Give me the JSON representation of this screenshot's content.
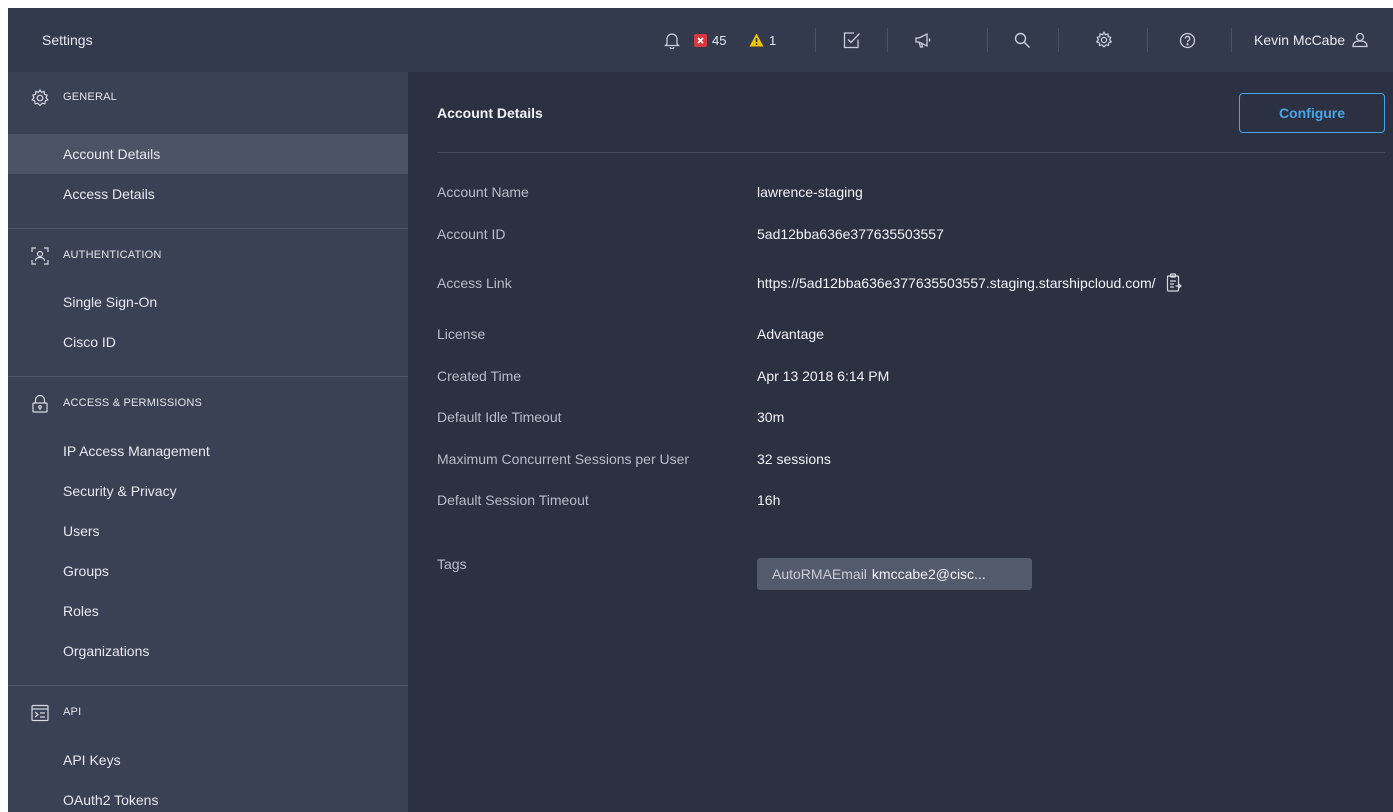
{
  "app": {
    "title": "Settings"
  },
  "topbar": {
    "errors_count": "45",
    "warnings_count": "1",
    "user_name": "Kevin McCabe",
    "icons": [
      "bell-icon",
      "error-icon",
      "warning-icon",
      "checklist-icon",
      "megaphone-icon",
      "search-icon",
      "gear-icon",
      "help-icon",
      "user-icon"
    ],
    "colors": {
      "error": "#d9363e",
      "warning": "#f2c500"
    }
  },
  "sidebar": {
    "sections": [
      {
        "title": "GENERAL",
        "icon": "gear-icon",
        "items": [
          "Account Details",
          "Access Details"
        ]
      },
      {
        "title": "AUTHENTICATION",
        "icon": "user-scan-icon",
        "items": [
          "Single Sign-On",
          "Cisco ID"
        ]
      },
      {
        "title": "ACCESS & PERMISSIONS",
        "icon": "lock-icon",
        "items": [
          "IP Access Management",
          "Security & Privacy",
          "Users",
          "Groups",
          "Roles",
          "Organizations"
        ]
      },
      {
        "title": "API",
        "icon": "terminal-icon",
        "items": [
          "API Keys",
          "OAuth2 Tokens"
        ]
      }
    ],
    "active_item": "Account Details"
  },
  "main": {
    "title": "Account Details",
    "configure_label": "Configure",
    "accent": "#49a6e6",
    "details": [
      {
        "label": "Account Name",
        "value": "lawrence-staging"
      },
      {
        "label": "Account ID",
        "value": "5ad12bba636e377635503557"
      },
      {
        "label": "Access Link",
        "value": "https://5ad12bba636e377635503557.staging.starshipcloud.com/"
      },
      {
        "label": "License",
        "value": "Advantage"
      },
      {
        "label": "Created Time",
        "value": "Apr 13 2018 6:14 PM"
      },
      {
        "label": "Default Idle Timeout",
        "value": "30m"
      },
      {
        "label": "Maximum Concurrent Sessions per User",
        "value": "32 sessions"
      },
      {
        "label": "Default Session Timeout",
        "value": "16h"
      }
    ],
    "tags": {
      "label": "Tags",
      "key": "AutoRMAEmail",
      "value": "kmccabe2@cisc..."
    }
  }
}
